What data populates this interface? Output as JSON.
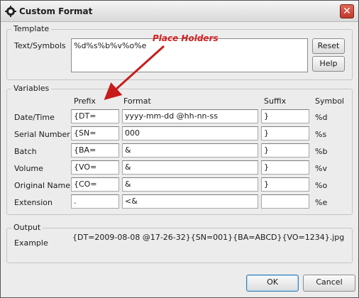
{
  "window": {
    "title": "Custom Format"
  },
  "annotation": {
    "text": "Place Holders",
    "color": "#d42020"
  },
  "template": {
    "legend": "Template",
    "label": "Text/Symbols",
    "value": "%d%s%b%v%o%e",
    "reset_label": "Reset",
    "help_label": "Help"
  },
  "variables": {
    "legend": "Variables",
    "headers": {
      "prefix": "Prefix",
      "format": "Format",
      "suffix": "Suffix",
      "symbol": "Symbol"
    },
    "rows": [
      {
        "name": "Date/Time",
        "prefix": "{DT=",
        "format": "yyyy-mm-dd @hh-nn-ss",
        "suffix": "}",
        "symbol": "%d"
      },
      {
        "name": "Serial Number",
        "prefix": "{SN=",
        "format": "000",
        "suffix": "}",
        "symbol": "%s"
      },
      {
        "name": "Batch",
        "prefix": "{BA=",
        "format": "&",
        "suffix": "}",
        "symbol": "%b"
      },
      {
        "name": "Volume",
        "prefix": "{VO=",
        "format": "&",
        "suffix": "}",
        "symbol": "%v"
      },
      {
        "name": "Original Name",
        "prefix": "{CO=",
        "format": "&",
        "suffix": "}",
        "symbol": "%o"
      },
      {
        "name": "Extension",
        "prefix": ".",
        "format": "<&",
        "suffix": "",
        "symbol": "%e"
      }
    ]
  },
  "output": {
    "legend": "Output",
    "label": "Example",
    "value": "{DT=2009-08-08 @17-26-32}{SN=001}{BA=ABCD}{VO=1234}.jpg"
  },
  "footer": {
    "ok_label": "OK",
    "cancel_label": "Cancel"
  }
}
